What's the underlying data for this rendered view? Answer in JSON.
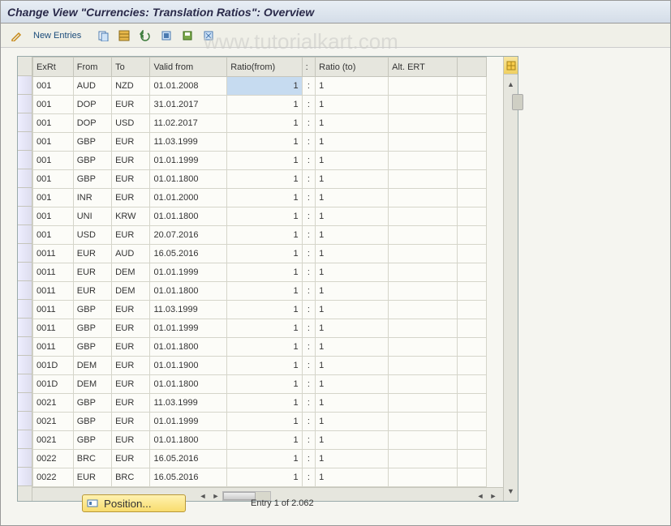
{
  "header": {
    "title": "Change View \"Currencies: Translation Ratios\": Overview"
  },
  "watermark": "www.tutorialkart.com",
  "toolbar": {
    "new_entries_label": "New Entries",
    "icons": [
      "pencil-icon",
      "copy-icon",
      "grid-copy-icon",
      "undo-icon",
      "select-all-icon",
      "save-icon",
      "deselect-icon"
    ]
  },
  "grid": {
    "columns": [
      "ExRt",
      "From",
      "To",
      "Valid from",
      "Ratio(from)",
      ":",
      "Ratio (to)",
      "Alt. ERT",
      ""
    ],
    "rows": [
      {
        "exrt": "001",
        "from": "AUD",
        "to": "NZD",
        "valid": "01.01.2008",
        "rfrom": "1",
        "colon": ":",
        "rto": "1",
        "alt": "",
        "selected": true
      },
      {
        "exrt": "001",
        "from": "DOP",
        "to": "EUR",
        "valid": "31.01.2017",
        "rfrom": "1",
        "colon": ":",
        "rto": "1",
        "alt": ""
      },
      {
        "exrt": "001",
        "from": "DOP",
        "to": "USD",
        "valid": "11.02.2017",
        "rfrom": "1",
        "colon": ":",
        "rto": "1",
        "alt": ""
      },
      {
        "exrt": "001",
        "from": "GBP",
        "to": "EUR",
        "valid": "11.03.1999",
        "rfrom": "1",
        "colon": ":",
        "rto": "1",
        "alt": ""
      },
      {
        "exrt": "001",
        "from": "GBP",
        "to": "EUR",
        "valid": "01.01.1999",
        "rfrom": "1",
        "colon": ":",
        "rto": "1",
        "alt": ""
      },
      {
        "exrt": "001",
        "from": "GBP",
        "to": "EUR",
        "valid": "01.01.1800",
        "rfrom": "1",
        "colon": ":",
        "rto": "1",
        "alt": ""
      },
      {
        "exrt": "001",
        "from": "INR",
        "to": "EUR",
        "valid": "01.01.2000",
        "rfrom": "1",
        "colon": ":",
        "rto": "1",
        "alt": ""
      },
      {
        "exrt": "001",
        "from": "UNI",
        "to": "KRW",
        "valid": "01.01.1800",
        "rfrom": "1",
        "colon": ":",
        "rto": "1",
        "alt": ""
      },
      {
        "exrt": "001",
        "from": "USD",
        "to": "EUR",
        "valid": "20.07.2016",
        "rfrom": "1",
        "colon": ":",
        "rto": "1",
        "alt": ""
      },
      {
        "exrt": "0011",
        "from": "EUR",
        "to": "AUD",
        "valid": "16.05.2016",
        "rfrom": "1",
        "colon": ":",
        "rto": "1",
        "alt": ""
      },
      {
        "exrt": "0011",
        "from": "EUR",
        "to": "DEM",
        "valid": "01.01.1999",
        "rfrom": "1",
        "colon": ":",
        "rto": "1",
        "alt": ""
      },
      {
        "exrt": "0011",
        "from": "EUR",
        "to": "DEM",
        "valid": "01.01.1800",
        "rfrom": "1",
        "colon": ":",
        "rto": "1",
        "alt": ""
      },
      {
        "exrt": "0011",
        "from": "GBP",
        "to": "EUR",
        "valid": "11.03.1999",
        "rfrom": "1",
        "colon": ":",
        "rto": "1",
        "alt": ""
      },
      {
        "exrt": "0011",
        "from": "GBP",
        "to": "EUR",
        "valid": "01.01.1999",
        "rfrom": "1",
        "colon": ":",
        "rto": "1",
        "alt": ""
      },
      {
        "exrt": "0011",
        "from": "GBP",
        "to": "EUR",
        "valid": "01.01.1800",
        "rfrom": "1",
        "colon": ":",
        "rto": "1",
        "alt": ""
      },
      {
        "exrt": "001D",
        "from": "DEM",
        "to": "EUR",
        "valid": "01.01.1900",
        "rfrom": "1",
        "colon": ":",
        "rto": "1",
        "alt": ""
      },
      {
        "exrt": "001D",
        "from": "DEM",
        "to": "EUR",
        "valid": "01.01.1800",
        "rfrom": "1",
        "colon": ":",
        "rto": "1",
        "alt": ""
      },
      {
        "exrt": "0021",
        "from": "GBP",
        "to": "EUR",
        "valid": "11.03.1999",
        "rfrom": "1",
        "colon": ":",
        "rto": "1",
        "alt": ""
      },
      {
        "exrt": "0021",
        "from": "GBP",
        "to": "EUR",
        "valid": "01.01.1999",
        "rfrom": "1",
        "colon": ":",
        "rto": "1",
        "alt": ""
      },
      {
        "exrt": "0021",
        "from": "GBP",
        "to": "EUR",
        "valid": "01.01.1800",
        "rfrom": "1",
        "colon": ":",
        "rto": "1",
        "alt": ""
      },
      {
        "exrt": "0022",
        "from": "BRC",
        "to": "EUR",
        "valid": "16.05.2016",
        "rfrom": "1",
        "colon": ":",
        "rto": "1",
        "alt": ""
      },
      {
        "exrt": "0022",
        "from": "EUR",
        "to": "BRC",
        "valid": "16.05.2016",
        "rfrom": "1",
        "colon": ":",
        "rto": "1",
        "alt": ""
      }
    ]
  },
  "footer": {
    "position_label": "Position...",
    "entry_text": "Entry 1 of 2.062"
  }
}
